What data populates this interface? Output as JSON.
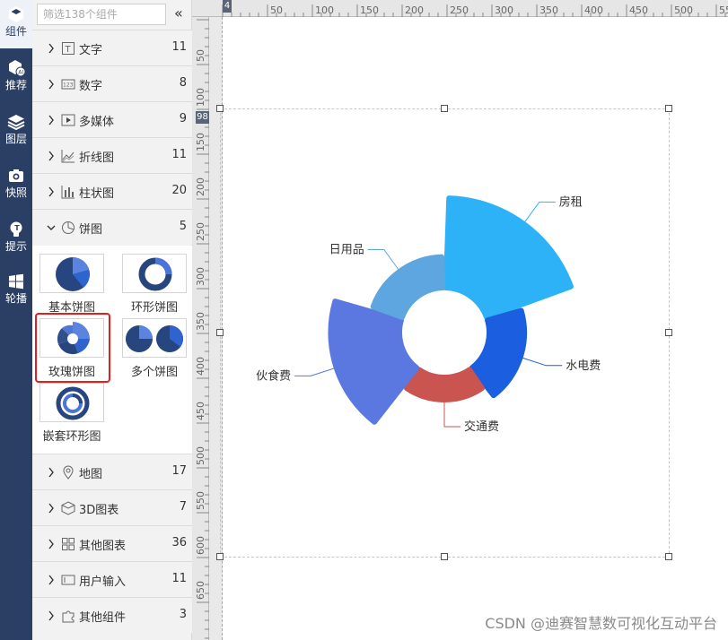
{
  "rail": {
    "items": [
      {
        "label": "组件",
        "icon": "cube-icon",
        "active": true
      },
      {
        "label": "推荐",
        "icon": "ai-cube-icon",
        "active": false
      },
      {
        "label": "图层",
        "icon": "layers-icon",
        "active": false
      },
      {
        "label": "快照",
        "icon": "camera-icon",
        "active": false
      },
      {
        "label": "提示",
        "icon": "lightbulb-icon",
        "active": false
      },
      {
        "label": "轮播",
        "icon": "windows-icon",
        "active": false
      }
    ]
  },
  "panel": {
    "search_placeholder": "筛选138个组件",
    "collapse_glyph": "«",
    "categories_top": [
      {
        "name": "文字",
        "count": "11",
        "icon": "text-icon"
      },
      {
        "name": "数字",
        "count": "8",
        "icon": "number-icon"
      },
      {
        "name": "多媒体",
        "count": "9",
        "icon": "media-icon"
      },
      {
        "name": "折线图",
        "count": "11",
        "icon": "line-chart-icon"
      },
      {
        "name": "柱状图",
        "count": "20",
        "icon": "bar-chart-icon"
      },
      {
        "name": "饼图",
        "count": "5",
        "icon": "pie-chart-icon"
      }
    ],
    "pie_items": [
      {
        "label": "基本饼图"
      },
      {
        "label": "环形饼图"
      },
      {
        "label": "玫瑰饼图"
      },
      {
        "label": "多个饼图"
      },
      {
        "label": "嵌套环形图"
      }
    ],
    "categories_bottom": [
      {
        "name": "地图",
        "count": "17",
        "icon": "map-icon"
      },
      {
        "name": "3D图表",
        "count": "7",
        "icon": "cube3d-icon"
      },
      {
        "name": "其他图表",
        "count": "36",
        "icon": "grid-icon"
      },
      {
        "name": "用户输入",
        "count": "11",
        "icon": "input-icon"
      },
      {
        "name": "其他组件",
        "count": "3",
        "icon": "puzzle-icon"
      }
    ]
  },
  "ruler": {
    "top_labels": [
      "50",
      "100",
      "150",
      "200",
      "250",
      "300",
      "350",
      "400",
      "450",
      "500",
      "550"
    ],
    "left_labels": [
      "50",
      "100",
      "150",
      "200",
      "250",
      "300",
      "350",
      "400",
      "450",
      "500",
      "550",
      "600",
      "650"
    ],
    "top_marker": "4",
    "left_marker": "98"
  },
  "chart_data": {
    "type": "pie",
    "subtype": "rose",
    "series": [
      {
        "name": "房租",
        "value": 100,
        "color": "#2eb2f7"
      },
      {
        "name": "水电费",
        "value": 35,
        "color": "#1c5ee0"
      },
      {
        "name": "交通费",
        "value": 20,
        "color": "#c95450"
      },
      {
        "name": "伙食费",
        "value": 75,
        "color": "#5a78e0"
      },
      {
        "name": "日用品",
        "value": 30,
        "color": "#5ea6e0"
      }
    ]
  },
  "watermark": "CSDN @迪赛智慧数可视化互动平台"
}
